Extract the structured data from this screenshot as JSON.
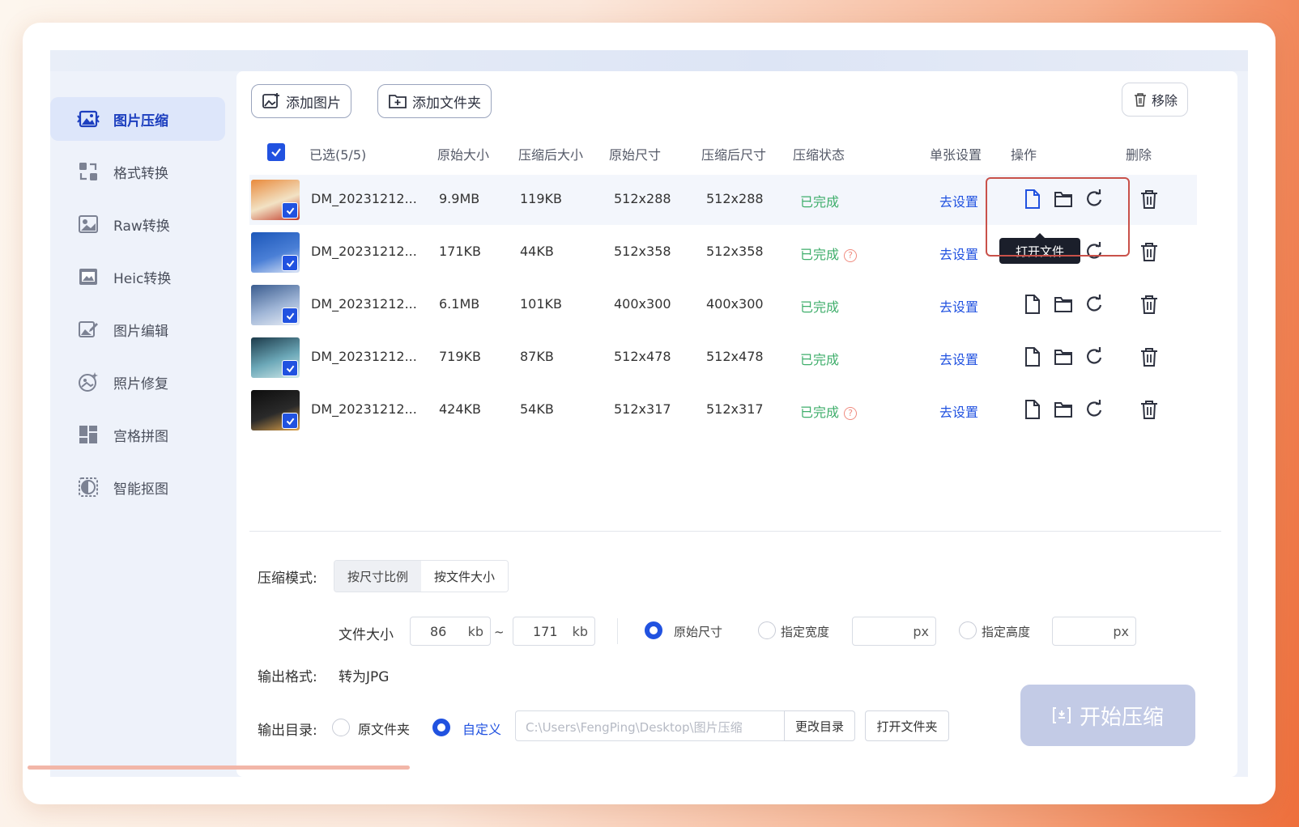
{
  "sidebar": {
    "items": [
      {
        "label": "图片压缩",
        "icon": "image-compress-icon",
        "active": true
      },
      {
        "label": "格式转换",
        "icon": "format-convert-icon"
      },
      {
        "label": "Raw转换",
        "icon": "raw-convert-icon"
      },
      {
        "label": "Heic转换",
        "icon": "heic-convert-icon"
      },
      {
        "label": "图片编辑",
        "icon": "image-edit-icon"
      },
      {
        "label": "照片修复",
        "icon": "photo-repair-icon"
      },
      {
        "label": "宫格拼图",
        "icon": "grid-collage-icon"
      },
      {
        "label": "智能抠图",
        "icon": "smart-cutout-icon"
      }
    ]
  },
  "toolbar": {
    "add_image": "添加图片",
    "add_folder": "添加文件夹",
    "remove": "移除"
  },
  "table": {
    "headers": {
      "selected": "已选(5/5)",
      "orig_size": "原始大小",
      "comp_size": "压缩后大小",
      "orig_dim": "原始尺寸",
      "comp_dim": "压缩后尺寸",
      "status": "压缩状态",
      "single": "单张设置",
      "ops": "操作",
      "delete": "删除"
    },
    "rows": [
      {
        "name": "DM_20231212...",
        "orig_size": "9.9MB",
        "comp_size": "119KB",
        "orig_dim": "512x288",
        "comp_dim": "512x288",
        "status": "已完成",
        "help": false,
        "setting": "去设置",
        "thumb_colors": [
          "#e98a3c",
          "#f2e2c4",
          "#c23b2a"
        ]
      },
      {
        "name": "DM_20231212...",
        "orig_size": "171KB",
        "comp_size": "44KB",
        "orig_dim": "512x358",
        "comp_dim": "512x358",
        "status": "已完成",
        "help": true,
        "setting": "去设置",
        "thumb_colors": [
          "#1c57b9",
          "#4a7fd6",
          "#d9e3f5"
        ]
      },
      {
        "name": "DM_20231212...",
        "orig_size": "6.1MB",
        "comp_size": "101KB",
        "orig_dim": "400x300",
        "comp_dim": "400x300",
        "status": "已完成",
        "help": false,
        "setting": "去设置",
        "thumb_colors": [
          "#3a5c8f",
          "#9fb5d6",
          "#e8edf5"
        ]
      },
      {
        "name": "DM_20231212...",
        "orig_size": "719KB",
        "comp_size": "87KB",
        "orig_dim": "512x478",
        "comp_dim": "512x478",
        "status": "已完成",
        "help": false,
        "setting": "去设置",
        "thumb_colors": [
          "#1c3a4a",
          "#6ca8b8",
          "#cfe8e8"
        ]
      },
      {
        "name": "DM_20231212...",
        "orig_size": "424KB",
        "comp_size": "54KB",
        "orig_dim": "512x317",
        "comp_dim": "512x317",
        "status": "已完成",
        "help": true,
        "setting": "去设置",
        "thumb_colors": [
          "#0d0d0d",
          "#2a2a2a",
          "#e0a44a"
        ]
      }
    ],
    "tooltip": "打开文件"
  },
  "settings": {
    "mode_label": "压缩模式:",
    "mode_options": [
      "按尺寸比例",
      "按文件大小"
    ],
    "filesize_label": "文件大小",
    "min_size": "86",
    "max_size": "171",
    "unit_kb": "kb",
    "tilde": "~",
    "dim_options": [
      "原始尺寸",
      "指定宽度",
      "指定高度"
    ],
    "unit_px": "px",
    "format_label": "输出格式:",
    "format_value": "转为JPG",
    "dir_label": "输出目录:",
    "dir_options": [
      "原文件夹",
      "自定义"
    ],
    "dir_path": "C:\\Users\\FengPing\\Desktop\\图片压缩",
    "change_dir": "更改目录",
    "open_folder": "打开文件夹",
    "start": "开始压缩"
  },
  "colors": {
    "accent": "#2152e0",
    "status_done": "#3fae6b",
    "highlight_box": "#c9514a",
    "start_button": "#c3cbe6"
  }
}
